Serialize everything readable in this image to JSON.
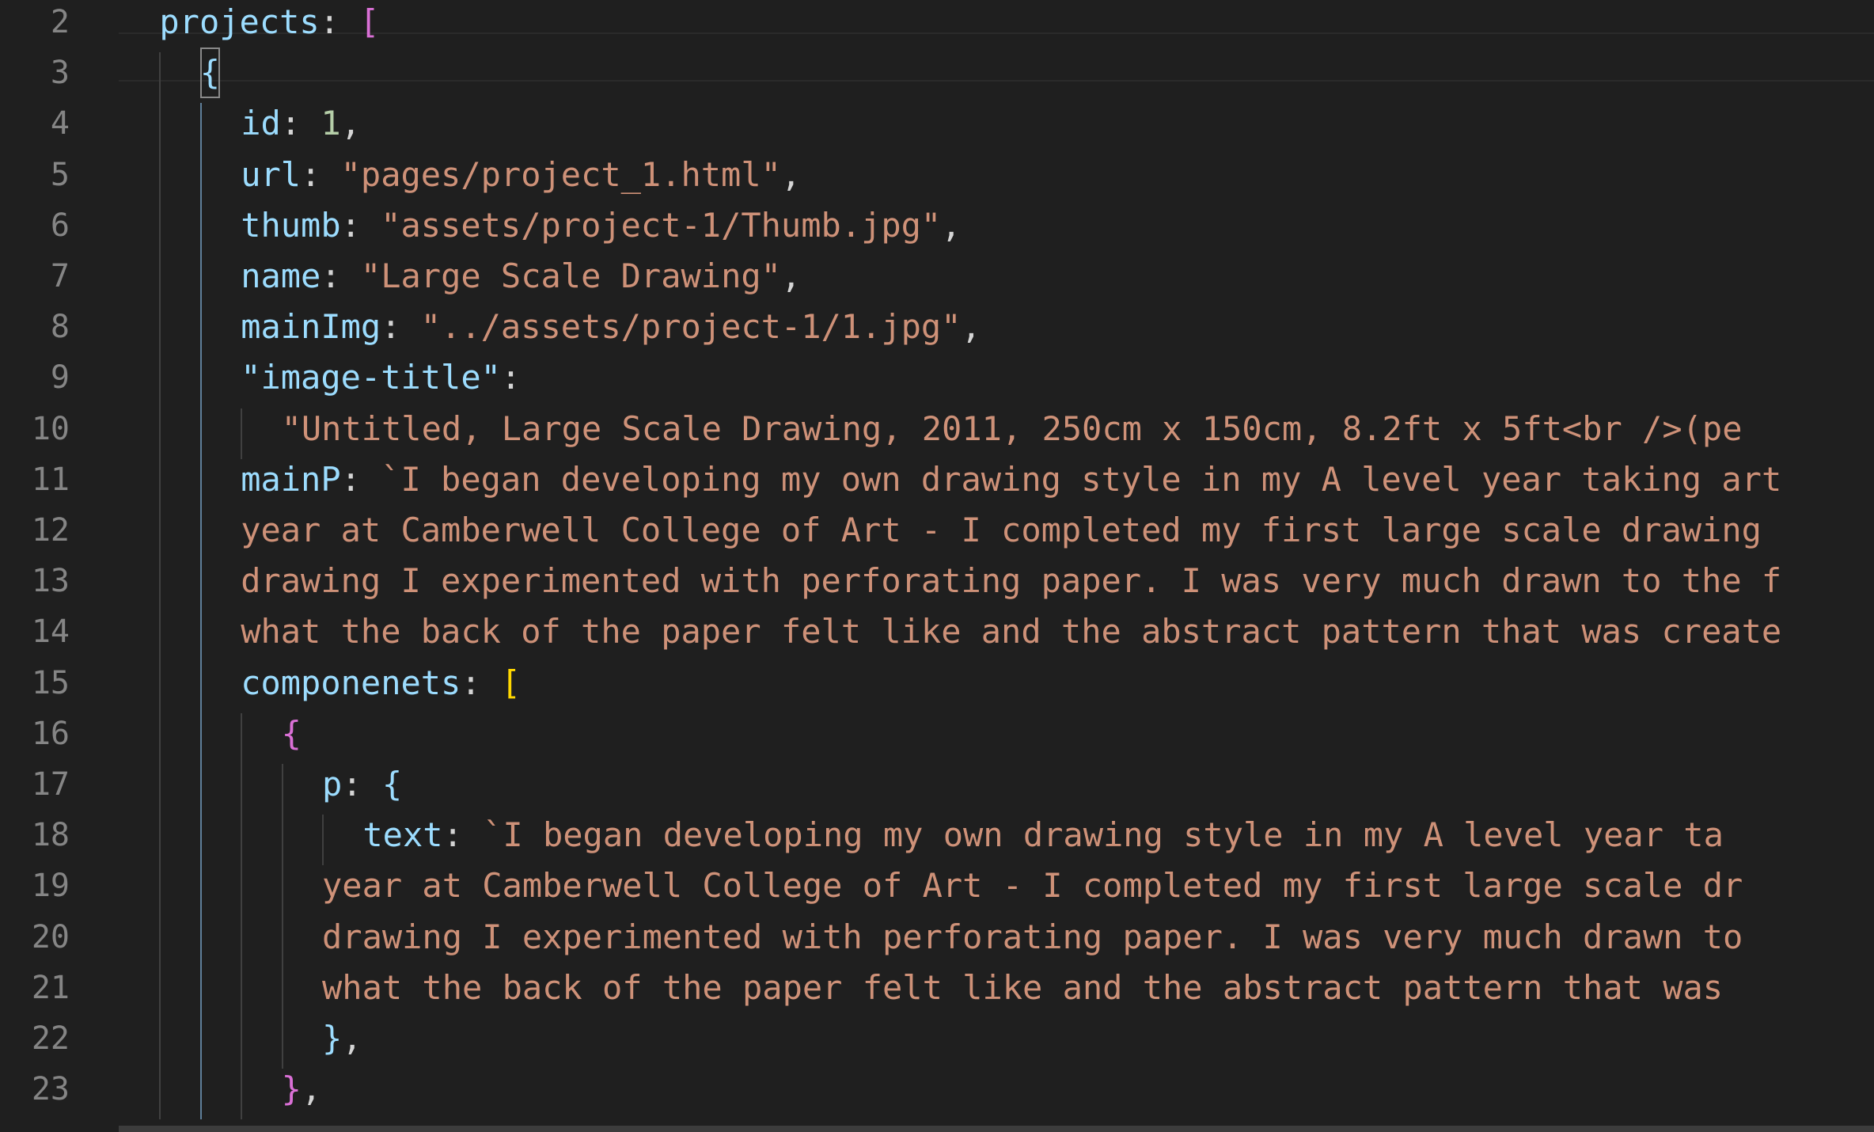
{
  "editor": {
    "line_numbers": [
      "2",
      "3",
      "4",
      "5",
      "6",
      "7",
      "8",
      "9",
      "10",
      "11",
      "12",
      "13",
      "14",
      "15",
      "16",
      "17",
      "18",
      "19",
      "20",
      "21",
      "22",
      "23"
    ],
    "lines": [
      {
        "key": "projects",
        "punct": ": ",
        "bracket": "["
      },
      {
        "bracket": "{"
      },
      {
        "key": "id",
        "punct": ": ",
        "number": "1",
        "tail": ","
      },
      {
        "key": "url",
        "punct": ": ",
        "string": "\"pages/project_1.html\"",
        "tail": ","
      },
      {
        "key": "thumb",
        "punct": ": ",
        "string": "\"assets/project-1/Thumb.jpg\"",
        "tail": ","
      },
      {
        "key": "name",
        "punct": ": ",
        "string": "\"Large Scale Drawing\"",
        "tail": ","
      },
      {
        "key": "mainImg",
        "punct": ": ",
        "string": "\"../assets/project-1/1.jpg\"",
        "tail": ","
      },
      {
        "key": "\"image-title\"",
        "punct": ":"
      },
      {
        "string": "\"Untitled, Large Scale Drawing, 2011, 250cm x 150cm, 8.2ft x 5ft<br />(pe"
      },
      {
        "key": "mainP",
        "punct": ": ",
        "string": "`I began developing my own drawing style in my A level year taking art"
      },
      {
        "string": "year at Camberwell College of Art - I completed my first large scale drawing"
      },
      {
        "string": "drawing I experimented with perforating paper. I was very much drawn to the f"
      },
      {
        "string": "what the back of the paper felt like and the abstract pattern that was create"
      },
      {
        "key": "componenets",
        "punct": ": ",
        "bracket": "["
      },
      {
        "bracket": "{"
      },
      {
        "key": "p",
        "punct": ": ",
        "bracket": "{"
      },
      {
        "key": "text",
        "punct": ": ",
        "string": "`I began developing my own drawing style in my A level year ta"
      },
      {
        "string": "year at Camberwell College of Art - I completed my first large scale dr"
      },
      {
        "string": "drawing I experimented with perforating paper. I was very much drawn to"
      },
      {
        "string": "what the back of the paper felt like and the abstract pattern that was"
      },
      {
        "bracket": "}",
        "tail": ","
      },
      {
        "bracket": "}",
        "tail": ","
      }
    ]
  },
  "colors": {
    "background": "#1f1f1f",
    "line_number": "#858585",
    "property": "#9cdcfe",
    "string": "#ce9178",
    "number": "#b5cea8",
    "bracket_magenta": "#da70d6",
    "bracket_yellow": "#ffd700",
    "bracket_blue": "#179fff"
  }
}
